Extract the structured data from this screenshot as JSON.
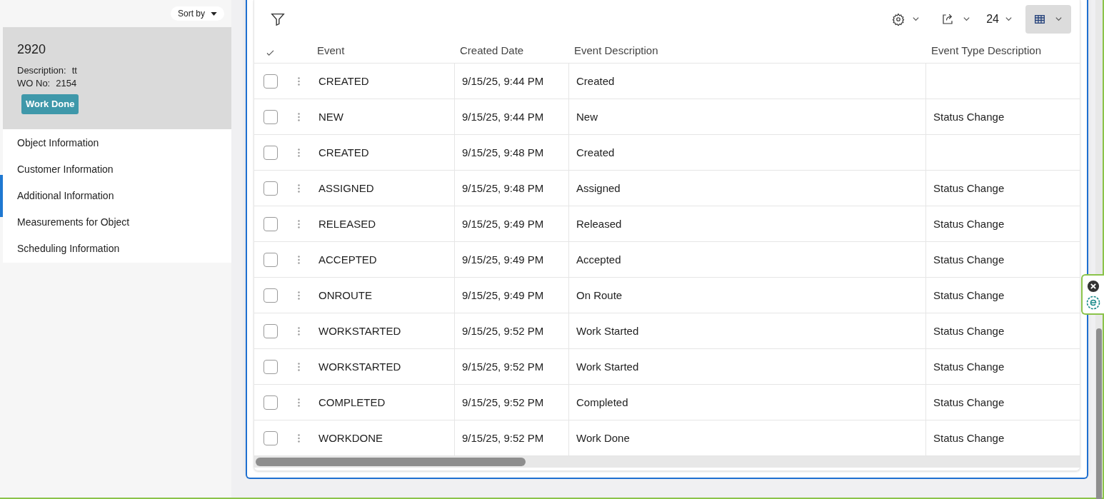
{
  "sidebar": {
    "sort_label": "Sort by",
    "record": {
      "title": "2920",
      "fields": [
        {
          "label": "Description:",
          "value": "tt"
        },
        {
          "label": "WO No:",
          "value": "2154"
        }
      ],
      "status": "Work Done"
    },
    "items": [
      {
        "label": "Object Information",
        "selected": false
      },
      {
        "label": "Customer Information",
        "selected": false
      },
      {
        "label": "Additional Information",
        "selected": true
      },
      {
        "label": "Measurements for Object",
        "selected": false
      },
      {
        "label": "Scheduling Information",
        "selected": false
      }
    ]
  },
  "toolbar": {
    "page_size": "24"
  },
  "table": {
    "columns": [
      "Event",
      "Created Date",
      "Event Description",
      "Event Type Description"
    ],
    "rows": [
      {
        "cells": [
          "CREATED",
          "9/15/25, 9:44 PM",
          "Created",
          ""
        ],
        "checked": false
      },
      {
        "cells": [
          "NEW",
          "9/15/25, 9:44 PM",
          "New",
          "Status Change"
        ],
        "checked": false
      },
      {
        "cells": [
          "CREATED",
          "9/15/25, 9:48 PM",
          "Created",
          ""
        ],
        "checked": false
      },
      {
        "cells": [
          "ASSIGNED",
          "9/15/25, 9:48 PM",
          "Assigned",
          "Status Change"
        ],
        "checked": false
      },
      {
        "cells": [
          "RELEASED",
          "9/15/25, 9:49 PM",
          "Released",
          "Status Change"
        ],
        "checked": false
      },
      {
        "cells": [
          "ACCEPTED",
          "9/15/25, 9:49 PM",
          "Accepted",
          "Status Change"
        ],
        "checked": false
      },
      {
        "cells": [
          "ONROUTE",
          "9/15/25, 9:49 PM",
          "On Route",
          "Status Change"
        ],
        "checked": false
      },
      {
        "cells": [
          "WORKSTARTED",
          "9/15/25, 9:52 PM",
          "Work Started",
          "Status Change"
        ],
        "checked": false
      },
      {
        "cells": [
          "WORKSTARTED",
          "9/15/25, 9:52 PM",
          "Work Started",
          "Status Change"
        ],
        "checked": false
      },
      {
        "cells": [
          "COMPLETED",
          "9/15/25, 9:52 PM",
          "Completed",
          "Status Change"
        ],
        "checked": false
      },
      {
        "cells": [
          "WORKDONE",
          "9/15/25, 9:52 PM",
          "Work Done",
          "Status Change"
        ],
        "checked": false
      }
    ]
  }
}
